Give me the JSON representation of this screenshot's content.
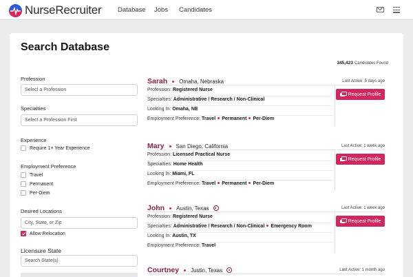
{
  "header": {
    "brand": "NurseRecruiter",
    "nav": [
      "Database",
      "Jobs",
      "Candidates"
    ],
    "icons": [
      "mail-icon",
      "menu-icon"
    ],
    "accent": "#d12660"
  },
  "page": {
    "title": "Search Database",
    "count": "345,423",
    "count_label": "Candidates Found"
  },
  "filters": {
    "profession_label": "Profession",
    "profession_placeholder": "Select a Profession",
    "specialties_label": "Specialties",
    "specialties_placeholder": "Select a Profession First",
    "experience_label": "Experience",
    "experience_option": "Require 1+ Year Experience",
    "employment_label": "Employment Preference",
    "employment_options": [
      "Travel",
      "Permanent",
      "Per-Diem"
    ],
    "locations_label": "Desired Locations",
    "locations_placeholder": "City, State, or Zip",
    "relocation_label": "Allow Relocation",
    "relocation_checked": true,
    "licensure_label": "Licensure State",
    "licensure_placeholder": "Search State(s)"
  },
  "labels": {
    "profession": "Profession:",
    "specialties": "Specialties:",
    "looking_in": "Looking In:",
    "employment": "Employment Preference:",
    "request": "Request Profile"
  },
  "results": [
    {
      "name": "Sarah",
      "location": "Omaha, Nebraska",
      "badge": false,
      "last_active": "Last Active: 5 days ago",
      "profession": "Registered Nurse",
      "specialties": "Administrative / Research / Non-Clinical",
      "looking_in": "Omaha, NE",
      "prefs": [
        "Travel",
        "Permanent",
        "Per-Diem"
      ]
    },
    {
      "name": "Mary",
      "location": "San Diego, California",
      "badge": false,
      "last_active": "Last Active: 1 week ago",
      "profession": "Licensed Practical Nurse",
      "specialties": "Home Health",
      "looking_in": "Miami, FL",
      "prefs": [
        "Travel",
        "Permanent",
        "Per-Diem"
      ]
    },
    {
      "name": "John",
      "location": "Austin, Texas",
      "badge": true,
      "last_active": "Last Active: 1 week ago",
      "profession": "Registered Nurse",
      "specialties": "Administrative / Research / Non-Clinical",
      "specialties_extra": "Emergency Room",
      "looking_in": "Austin, TX",
      "prefs": [
        "Travel"
      ]
    },
    {
      "name": "Courtney",
      "location": "Justin, Texas",
      "badge": true,
      "last_active": "Last Active: 1 month ago"
    }
  ]
}
